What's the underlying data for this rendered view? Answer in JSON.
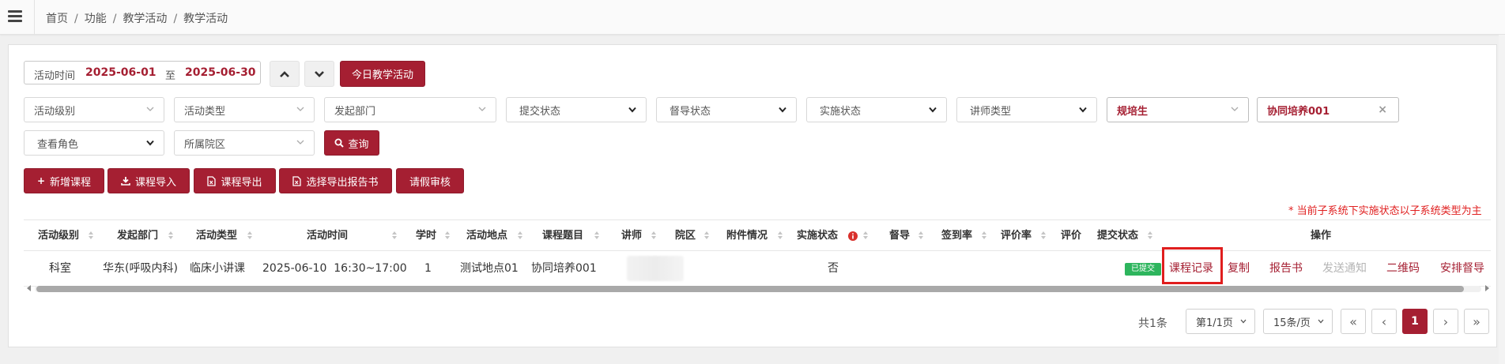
{
  "breadcrumb": [
    "首页",
    "功能",
    "教学活动",
    "教学活动"
  ],
  "date_filter": {
    "label": "活动时间",
    "start": "2025-06-01",
    "separator": "至",
    "end": "2025-06-30"
  },
  "today_button": "今日教学活动",
  "filters": {
    "activity_level": "活动级别",
    "activity_type": "活动类型",
    "department": "发起部门",
    "submit_status": "提交状态",
    "supervise_status": "督导状态",
    "impl_status": "实施状态",
    "lecturer_type": "讲师类型",
    "trainee_type": "规培生",
    "course_title": "协同培养001",
    "view_role": "查看角色",
    "campus": "所属院区",
    "query_button": "查询"
  },
  "actions": {
    "add": "新增课程",
    "import": "课程导入",
    "export": "课程导出",
    "export_report": "选择导出报告书",
    "leave_review": "请假审核"
  },
  "note": "* 当前子系统下实施状态以子系统类型为主",
  "columns": {
    "level": "活动级别",
    "dept": "发起部门",
    "type": "活动类型",
    "time": "活动时间",
    "hours": "学时",
    "place": "活动地点",
    "title": "课程题目",
    "lecturer": "讲师",
    "campus": "院区",
    "attach": "附件情况",
    "impl": "实施状态",
    "supervise": "督导",
    "signin": "签到率",
    "rating": "评价率",
    "eval": "评价",
    "submit": "提交状态",
    "ops": "操作"
  },
  "rows": [
    {
      "level": "科室",
      "dept": "华东(呼吸内科)",
      "type": "临床小讲课",
      "time": "2025-06-10  16:30~17:00",
      "hours": "1",
      "place": "测试地点01",
      "title": "协同培养001",
      "impl": "否",
      "submit": "已提交",
      "ops": {
        "record": "课程记录",
        "copy": "复制",
        "report": "报告书",
        "notify": "发送通知",
        "qrcode": "二维码",
        "supervise": "安排督导"
      }
    }
  ],
  "pagination": {
    "total": "共1条",
    "page": "第1/1页",
    "per_page": "15条/页",
    "first": "«",
    "prev": "‹",
    "current": "1",
    "next": "›",
    "last": "»"
  },
  "colors": {
    "accent": "#a51f32",
    "success": "#2db55d",
    "highlight": "#e01e1e"
  }
}
